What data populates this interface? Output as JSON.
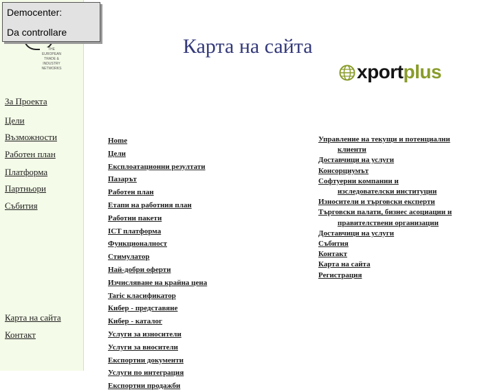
{
  "demo": {
    "line1": "Democenter:",
    "line2": "Da controllare"
  },
  "logo_small": {
    "text": "THE EUROPEAN TRADE & INDUSTRY NETWORKS"
  },
  "page_title": "Карта на сайта",
  "brand": {
    "part1": "xport",
    "part2": "plus",
    "accent": "#8a9c2b"
  },
  "sidebar_color": "#f4fbe8",
  "nav": [
    "За Проекта",
    "Цели",
    "Възможности",
    "Работен план",
    "Платформа",
    "Партньори",
    "Събития",
    "Карта на сайта",
    "Контакт"
  ],
  "sitemap_col1": [
    "Home",
    "Цели",
    "Експлоатационни резултати",
    "Пазарът",
    "Работен план",
    "Етапи на работния план",
    "Работни пакети",
    "ICT платформа",
    "Функционалност",
    "Стимулатор",
    "Най-добри оферти",
    "Изчисляване на крайна цена",
    "Taric класификатор",
    "Кибер - представяне",
    "Кибер - каталог",
    "Услуги за износители",
    "Услуги за вносители",
    "Експортни документи",
    "Услуги по интеграция",
    "Експортни продажби"
  ],
  "sitemap_col2": [
    {
      "first": "Управление на текущи и потенциални",
      "rest": "клиенти"
    },
    {
      "first": "Доставчици на услуги",
      "rest": ""
    },
    {
      "first": "Консорциумът",
      "rest": ""
    },
    {
      "first": "Софтуерни компании и",
      "rest": "изследователски институции"
    },
    {
      "first": "Износители и търговски експерти",
      "rest": ""
    },
    {
      "first": "Търговски палати, бизнес асоциации и",
      "rest": "правителствени организации"
    },
    {
      "first": "Доставчици на услуги",
      "rest": ""
    },
    {
      "first": "Събития",
      "rest": ""
    },
    {
      "first": "Контакт",
      "rest": ""
    },
    {
      "first": "Карта на сайта",
      "rest": ""
    },
    {
      "first": "Регистрация",
      "rest": ""
    }
  ]
}
